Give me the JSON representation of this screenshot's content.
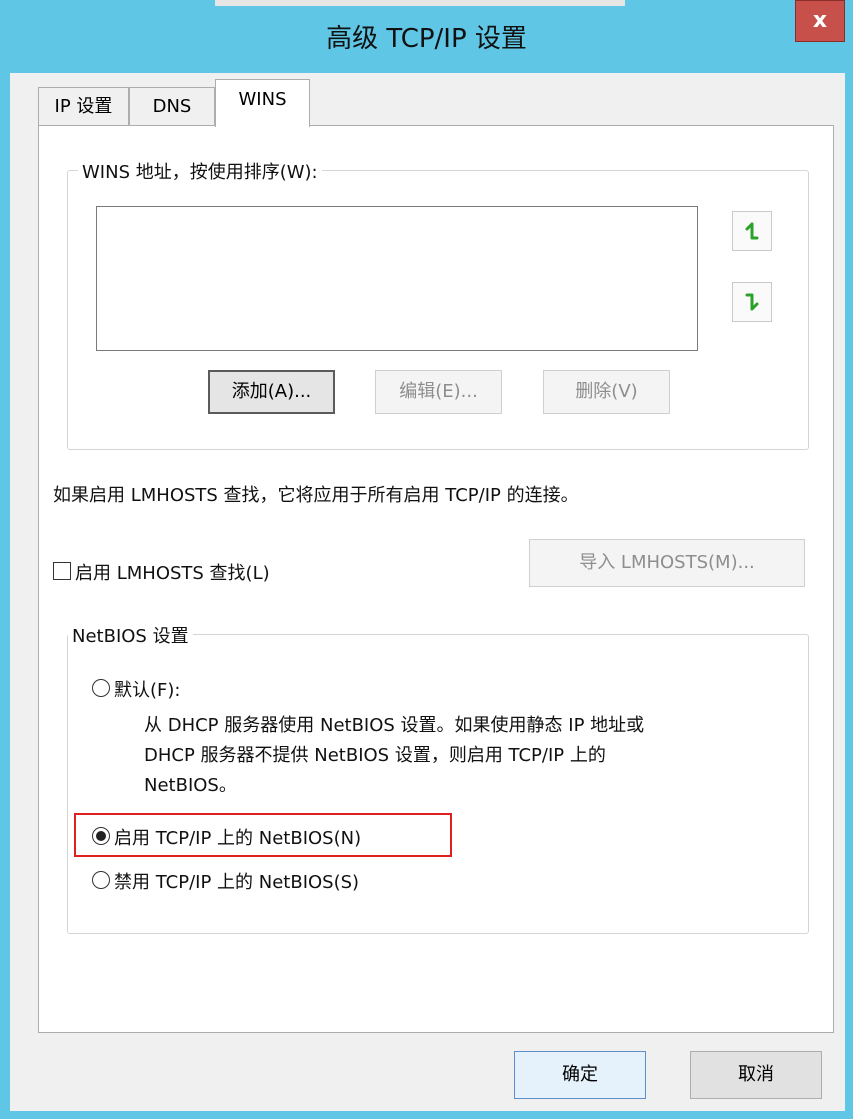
{
  "window": {
    "title": "高级 TCP/IP 设置",
    "close_glyph": "x",
    "titlebar_color": "#5fc7e5"
  },
  "tabs": [
    {
      "label": "IP 设置",
      "selected": false
    },
    {
      "label": "DNS",
      "selected": false
    },
    {
      "label": "WINS",
      "selected": true
    }
  ],
  "wins_group": {
    "label": "WINS 地址，按使用排序(W):",
    "addresses": [],
    "up_icon": "arrow-up-icon",
    "down_icon": "arrow-down-icon",
    "add_label": "添加(A)...",
    "edit_label": "编辑(E)...",
    "delete_label": "删除(V)"
  },
  "lmhosts": {
    "info_text": "如果启用 LMHOSTS 查找，它将应用于所有启用 TCP/IP 的连接。",
    "enable_label": "启用 LMHOSTS 查找(L)",
    "enable_checked": false,
    "import_label": "导入 LMHOSTS(M)..."
  },
  "netbios": {
    "label": "NetBIOS 设置",
    "default_label": "默认(F):",
    "default_desc_line1": "从 DHCP 服务器使用 NetBIOS 设置。如果使用静态 IP 地址或",
    "default_desc_line2": "DHCP 服务器不提供 NetBIOS 设置，则启用 TCP/IP 上的",
    "default_desc_line3": "NetBIOS。",
    "enable_label": "启用 TCP/IP 上的 NetBIOS(N)",
    "disable_label": "禁用 TCP/IP 上的 NetBIOS(S)",
    "selected": "enable",
    "highlight_color": "#e02020"
  },
  "footer": {
    "ok_label": "确定",
    "cancel_label": "取消"
  }
}
